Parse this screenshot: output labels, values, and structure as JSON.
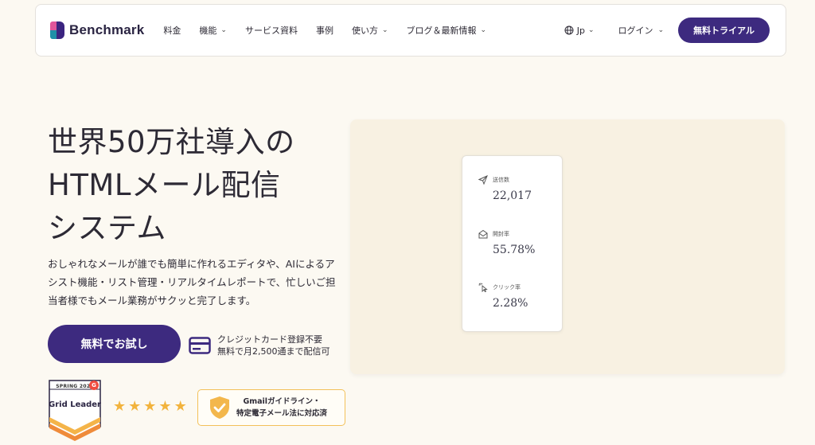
{
  "nav": {
    "logo_text": "Benchmark",
    "items": [
      {
        "label": "料金",
        "dropdown": false
      },
      {
        "label": "機能",
        "dropdown": true
      },
      {
        "label": "サービス資料",
        "dropdown": false
      },
      {
        "label": "事例",
        "dropdown": false
      },
      {
        "label": "使い方",
        "dropdown": true
      },
      {
        "label": "ブログ＆最新情報",
        "dropdown": true
      }
    ],
    "lang": "Jp",
    "login": "ログイン",
    "trial": "無料トライアル"
  },
  "hero": {
    "title_line1": "世界50万社導入の",
    "title_line2": "HTMLメール配信",
    "title_line3": "システム",
    "desc": "おしゃれなメールが誰でも簡単に作れるエディタや、AIによるアシスト機能・リスト管理・リアルタイムレポートで、忙しいご担当者様でもメール業務がサクッと完了します。",
    "cta": "無料でお試し",
    "card_note_line1": "クレジットカード登録不要",
    "card_note_line2": "無料で月2,500通まで配信可"
  },
  "badges": {
    "g2_season": "SPRING 2025",
    "g2_logo": "G",
    "g2_label": "Grid Leader",
    "stars": 5,
    "gmail_line1": "Gmailガイドライン・",
    "gmail_line2": "特定電子メール法に対応済"
  },
  "stats": [
    {
      "label": "送信数",
      "value": "22,017",
      "icon": "send-icon"
    },
    {
      "label": "開封率",
      "value": "55.78%",
      "icon": "envelope-open-icon"
    },
    {
      "label": "クリック率",
      "value": "2.28%",
      "icon": "click-icon"
    }
  ],
  "colors": {
    "brand": "#3d2a7f",
    "background": "#fcf9f2",
    "panel": "#f8f1e2",
    "star": "#f2b33d",
    "badge_border": "#f3c15a"
  }
}
